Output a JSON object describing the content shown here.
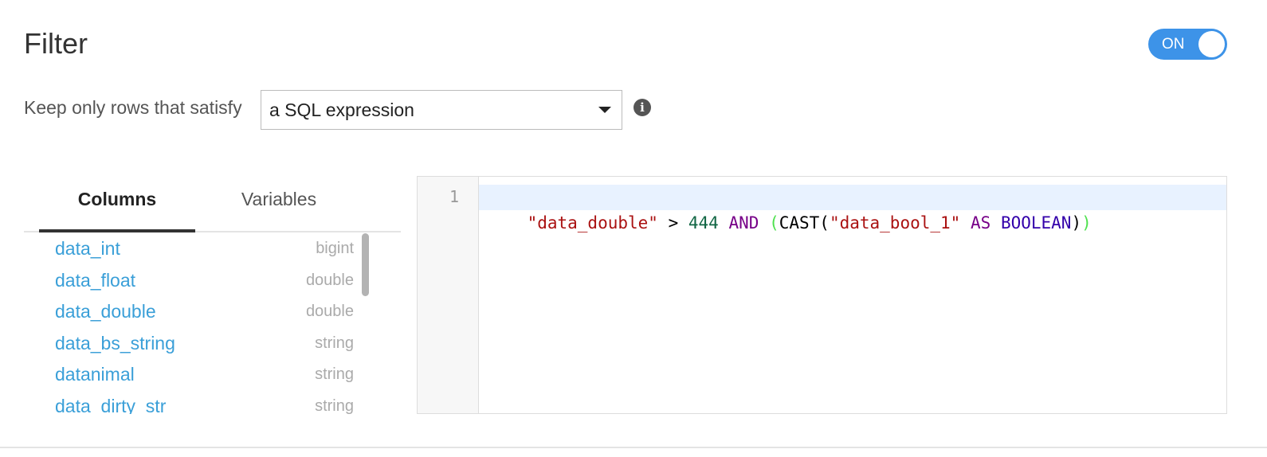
{
  "header": {
    "title": "Filter",
    "toggle": {
      "label": "ON",
      "state": "on",
      "color": "#3d93e8"
    }
  },
  "filter": {
    "keep_label": "Keep only rows that satisfy",
    "mode_select": {
      "value": "a SQL expression"
    },
    "info_icon": "info-icon"
  },
  "tabs": [
    {
      "label": "Columns",
      "active": true
    },
    {
      "label": "Variables",
      "active": false
    }
  ],
  "columns": [
    {
      "name": "data_int",
      "type": "bigint"
    },
    {
      "name": "data_float",
      "type": "double"
    },
    {
      "name": "data_double",
      "type": "double"
    },
    {
      "name": "data_bs_string",
      "type": "string"
    },
    {
      "name": "datanimal",
      "type": "string"
    },
    {
      "name": "data_dirty_str",
      "type": "string"
    }
  ],
  "editor": {
    "line_numbers": [
      "1"
    ],
    "tokens": [
      {
        "text": "\"data_double\"",
        "kind": "string"
      },
      {
        "text": " > ",
        "kind": "plain"
      },
      {
        "text": "444",
        "kind": "number"
      },
      {
        "text": " ",
        "kind": "plain"
      },
      {
        "text": "AND",
        "kind": "keyword"
      },
      {
        "text": " ",
        "kind": "plain"
      },
      {
        "text": "(",
        "kind": "bracket-match"
      },
      {
        "text": "CAST(",
        "kind": "plain"
      },
      {
        "text": "\"data_bool_1\"",
        "kind": "string"
      },
      {
        "text": " ",
        "kind": "plain"
      },
      {
        "text": "AS",
        "kind": "keyword"
      },
      {
        "text": " ",
        "kind": "plain"
      },
      {
        "text": "BOOLEAN",
        "kind": "builtin"
      },
      {
        "text": ")",
        "kind": "plain"
      },
      {
        "text": ")",
        "kind": "bracket-match"
      }
    ]
  },
  "colors": {
    "accent": "#3d93e8",
    "column_link": "#3a9fd8",
    "type_text": "#aaaaaa",
    "sql_string": "#aa1111",
    "sql_number": "#116644",
    "sql_keyword": "#770088",
    "sql_builtin": "#3300aa",
    "bracket_match": "#4fe14f"
  }
}
